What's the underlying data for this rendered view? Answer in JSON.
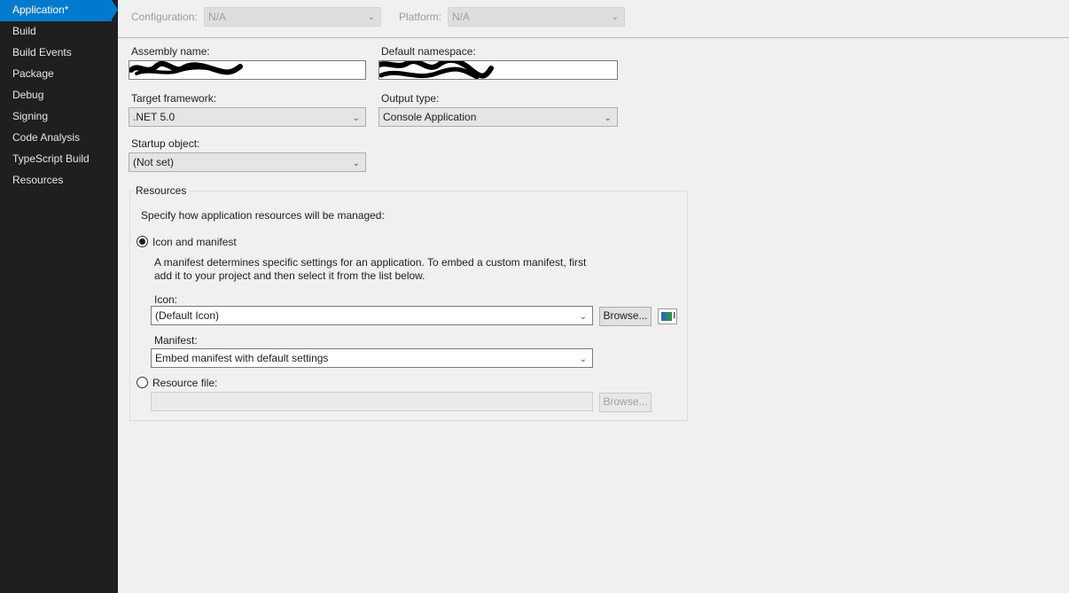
{
  "nav": {
    "items": [
      {
        "label": "Application*",
        "selected": true
      },
      {
        "label": "Build"
      },
      {
        "label": "Build Events"
      },
      {
        "label": "Package"
      },
      {
        "label": "Debug"
      },
      {
        "label": "Signing"
      },
      {
        "label": "Code Analysis"
      },
      {
        "label": "TypeScript Build"
      },
      {
        "label": "Resources"
      }
    ]
  },
  "config": {
    "configuration_label": "Configuration:",
    "configuration_value": "N/A",
    "platform_label": "Platform:",
    "platform_value": "N/A"
  },
  "general": {
    "assembly_name_label": "Assembly name:",
    "assembly_name_value": "",
    "default_namespace_label": "Default namespace:",
    "default_namespace_value": "",
    "target_framework_label": "Target framework:",
    "target_framework_value": ".NET 5.0",
    "output_type_label": "Output type:",
    "output_type_value": "Console Application",
    "startup_object_label": "Startup object:",
    "startup_object_value": "(Not set)"
  },
  "resources": {
    "group_title": "Resources",
    "description": "Specify how application resources will be managed:",
    "icon_manifest_label": "Icon and manifest",
    "icon_manifest_selected": true,
    "manifest_help_line1": "A manifest determines specific settings for an application. To embed a custom manifest, first",
    "manifest_help_line2": "add it to your project and then select it from the list below.",
    "icon_label": "Icon:",
    "icon_value": "(Default Icon)",
    "browse_label": "Browse...",
    "manifest_label": "Manifest:",
    "manifest_value": "Embed manifest with default settings",
    "resource_file_label": "Resource file:",
    "resource_file_selected": false,
    "resource_file_value": "",
    "resource_browse_label": "Browse..."
  },
  "colors": {
    "accent": "#007acc",
    "nav_background": "#1f1f1f",
    "page_background": "#f0f0f0"
  },
  "icons": {
    "select_chevron": "chevron-down-icon",
    "icon_preview": "application-icon"
  }
}
